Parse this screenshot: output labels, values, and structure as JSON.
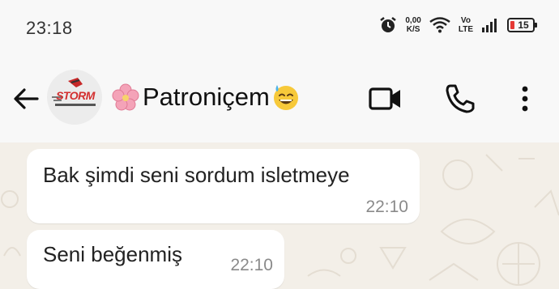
{
  "status_bar": {
    "time": "23:18",
    "net_speed_value": "0,00",
    "net_speed_unit": "K/S",
    "volte_top": "Vo",
    "volte_bottom": "LTE",
    "battery_level": "15",
    "battery_low_color": "#e53935"
  },
  "header": {
    "avatar_text": "STORM",
    "contact_name": "Patroniçem",
    "name_prefix_icon": "cherry-blossom-emoji",
    "name_suffix_icon": "sweat-smile-emoji",
    "icons": [
      "back-arrow-icon",
      "video-call-icon",
      "voice-call-icon",
      "more-vert-icon"
    ]
  },
  "messages": [
    {
      "text": "Bak şimdi seni sordum isletmeye",
      "time": "22:10"
    },
    {
      "text": "Seni beğenmiş",
      "time": "22:10"
    }
  ]
}
